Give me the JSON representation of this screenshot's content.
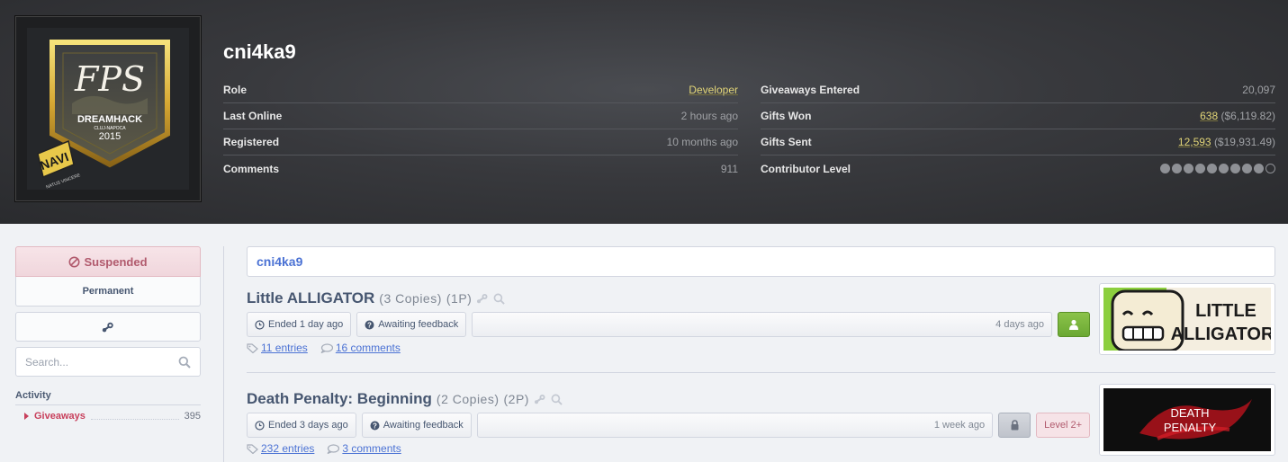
{
  "profile": {
    "username": "cni4ka9",
    "avatar_text": {
      "fps": "FPS",
      "event": "DREAMHACK",
      "location": "CLUJ-NAPOCA",
      "year": "2015",
      "team": "NAVI",
      "team_sub": "NATUS VINCERE"
    },
    "left_stats": [
      {
        "label": "Role",
        "value": "Developer",
        "style": "yellow"
      },
      {
        "label": "Last Online",
        "value": "2 hours ago"
      },
      {
        "label": "Registered",
        "value": "10 months ago"
      },
      {
        "label": "Comments",
        "value": "911"
      }
    ],
    "right_stats": {
      "giveaways_entered": {
        "label": "Giveaways Entered",
        "value": "20,097"
      },
      "gifts_won": {
        "label": "Gifts Won",
        "count": "638",
        "amount": "($6,119.82)"
      },
      "gifts_sent": {
        "label": "Gifts Sent",
        "count": "12,593",
        "amount": "($19,931.49)"
      },
      "contributor_level": {
        "label": "Contributor Level",
        "filled": 9,
        "total": 10
      }
    }
  },
  "sidebar": {
    "suspended_label": "Suspended",
    "permanent_label": "Permanent",
    "steam_icon": "steam-icon",
    "search_placeholder": "Search...",
    "activity_heading": "Activity",
    "items": [
      {
        "label": "Giveaways",
        "count": "395"
      }
    ]
  },
  "main": {
    "heading": "cni4ka9",
    "giveaways": [
      {
        "name": "Little ALLIGATOR",
        "copies": "(3 Copies)",
        "points": "(1P)",
        "ended": "Ended 1 day ago",
        "feedback": "Awaiting feedback",
        "created": "4 days ago",
        "entries": "11 entries",
        "comments": "16 comments",
        "thumb_text": [
          "LITTLE",
          "ALLIGATOR"
        ]
      },
      {
        "name": "Death Penalty: Beginning",
        "copies": "(2 Copies)",
        "points": "(2P)",
        "ended": "Ended 3 days ago",
        "feedback": "Awaiting feedback",
        "created": "1 week ago",
        "level": "Level 2+",
        "entries": "232 entries",
        "comments": "3 comments",
        "thumb_text": [
          "DEATH",
          "PENALTY"
        ]
      }
    ]
  },
  "colors": {
    "accent_blue": "#4b72d4",
    "yellow": "#e2d577",
    "suspended": "#b15a6d",
    "green": "#6ba833"
  }
}
